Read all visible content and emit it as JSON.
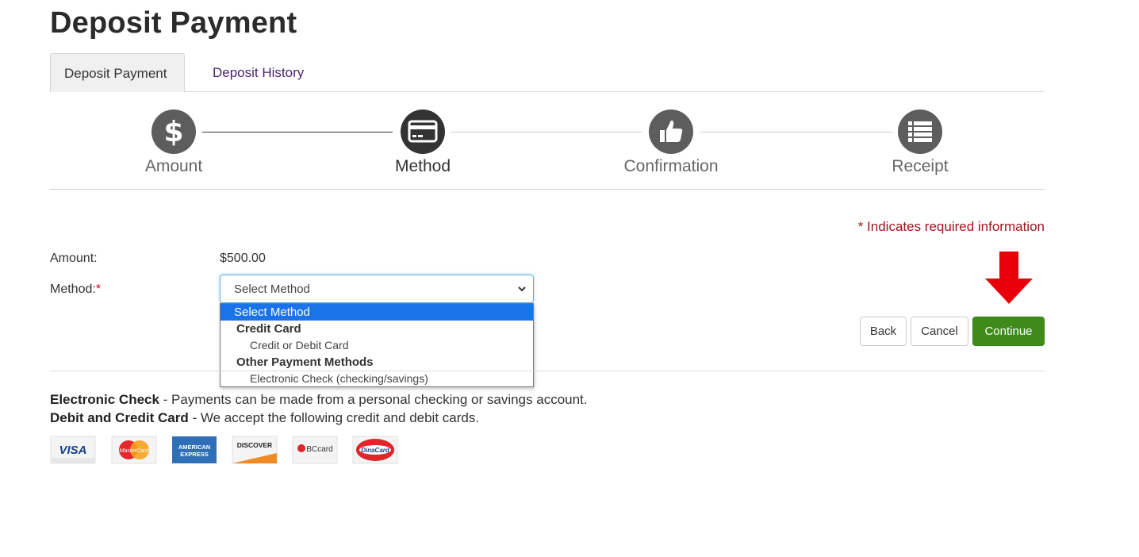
{
  "page": {
    "title": "Deposit Payment"
  },
  "tabs": [
    {
      "label": "Deposit Payment",
      "active": true
    },
    {
      "label": "Deposit History",
      "active": false
    }
  ],
  "steps": [
    {
      "label": "Amount",
      "icon": "dollar-icon",
      "state": "done"
    },
    {
      "label": "Method",
      "icon": "credit-card-icon",
      "state": "current"
    },
    {
      "label": "Confirmation",
      "icon": "thumbs-up-icon",
      "state": "upcoming"
    },
    {
      "label": "Receipt",
      "icon": "list-icon",
      "state": "upcoming"
    }
  ],
  "form": {
    "required_note": "* Indicates required information",
    "amount_label": "Amount:",
    "amount_value": "$500.00",
    "method_label": "Method:",
    "required_marker": "*",
    "method_selected": "Select Method",
    "method_options": {
      "placeholder": "Select Method",
      "group_1": "Credit Card",
      "group_1_option": "Credit or Debit Card",
      "group_2": "Other Payment Methods",
      "group_2_option": "Electronic Check (checking/savings)"
    }
  },
  "buttons": {
    "back": "Back",
    "cancel": "Cancel",
    "continue": "Continue"
  },
  "info": {
    "echeck_title": "Electronic Check",
    "echeck_text": " - Payments can be made from a personal checking or savings account.",
    "card_title": "Debit and Credit Card",
    "card_text": " - We accept the following credit and debit cards."
  },
  "cards": {
    "visa": "VISA",
    "mastercard": "MasterCard",
    "amex_line1": "AMERICAN",
    "amex_line2": "EXPRESS",
    "discover": "DISCOVER",
    "bccard": "BCcard",
    "dinacard": "DinaCard"
  },
  "colors": {
    "accent_green": "#3f8b1a",
    "required_red": "#a1141e",
    "link_purple": "#4b1f6f",
    "dropdown_highlight": "#1a73e8",
    "arrow_red": "#e8000b"
  }
}
